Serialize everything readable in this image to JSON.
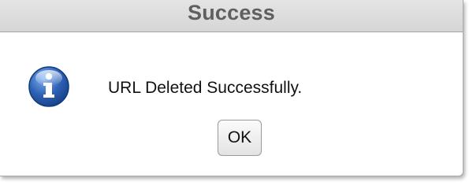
{
  "dialog": {
    "title": "Success",
    "message": "URL Deleted Successfully.",
    "icon": "info-icon",
    "ok_label": "OK"
  },
  "colors": {
    "title_text": "#5f5f5f",
    "titlebar_bg": "#dcdcdc",
    "icon_blue": "#2f62b5"
  }
}
